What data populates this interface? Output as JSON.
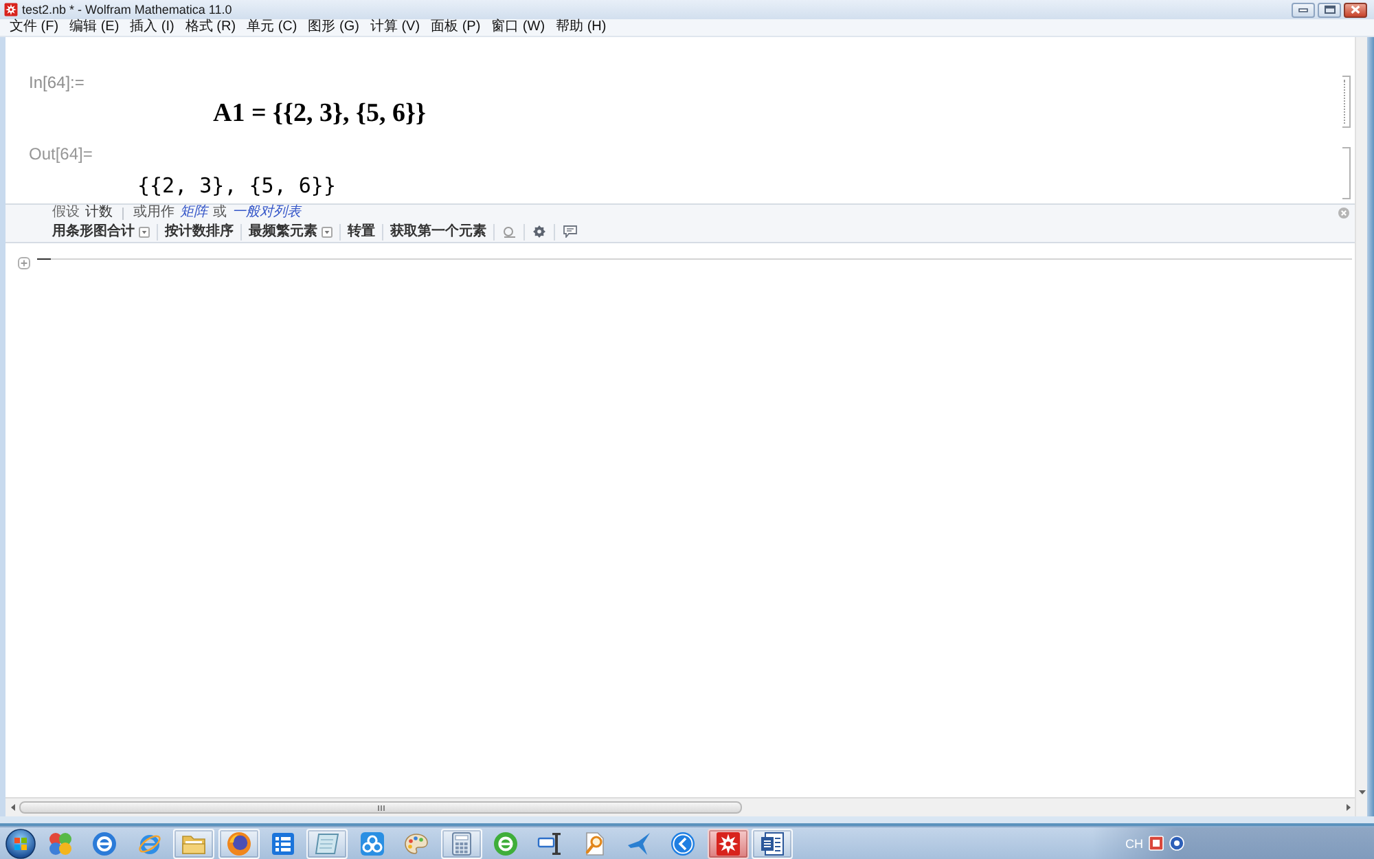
{
  "window": {
    "title": "test2.nb * - Wolfram Mathematica 11.0"
  },
  "menu": [
    "文件 (F)",
    "编辑 (E)",
    "插入 (I)",
    "格式 (R)",
    "单元 (C)",
    "图形 (G)",
    "计算 (V)",
    "面板 (P)",
    "窗口 (W)",
    "帮助 (H)"
  ],
  "notebook": {
    "cells": [
      {
        "kind": "input",
        "label": "In[64]:=",
        "content": "A1 = {{2, 3}, {5, 6}}"
      },
      {
        "kind": "output",
        "label": "Out[64]=",
        "content": "{{2, 3}, {5, 6}}"
      }
    ]
  },
  "suggestions_bar": {
    "assumption": [
      {
        "kind": "label",
        "text": "假设"
      },
      {
        "kind": "value",
        "text": "计数"
      }
    ],
    "alternatives": [
      {
        "kind": "text",
        "text": "或用作"
      },
      {
        "kind": "link",
        "text": "矩阵"
      },
      {
        "kind": "text",
        "text": "或"
      },
      {
        "kind": "link",
        "text": "一般对列表"
      }
    ],
    "actions": [
      {
        "label": "用条形图合计",
        "dropdown": true
      },
      {
        "label": "按计数排序",
        "dropdown": false
      },
      {
        "label": "最频繁元素",
        "dropdown": true
      },
      {
        "label": "转置",
        "dropdown": false
      },
      {
        "label": "获取第一个元素",
        "dropdown": false
      }
    ]
  },
  "taskbar": {
    "apps": [
      {
        "running": false,
        "active": false
      },
      {
        "running": false,
        "active": false
      },
      {
        "running": false,
        "active": false
      },
      {
        "running": true,
        "active": false
      },
      {
        "running": true,
        "active": false
      },
      {
        "running": false,
        "active": false
      },
      {
        "running": true,
        "active": false
      },
      {
        "running": false,
        "active": false
      },
      {
        "running": false,
        "active": false
      },
      {
        "running": true,
        "active": false
      },
      {
        "running": false,
        "active": false
      },
      {
        "running": false,
        "active": false
      },
      {
        "running": false,
        "active": false
      },
      {
        "running": false,
        "active": false
      },
      {
        "running": false,
        "active": false
      },
      {
        "running": true,
        "active": true
      },
      {
        "running": true,
        "active": false
      }
    ],
    "language": "CH"
  }
}
